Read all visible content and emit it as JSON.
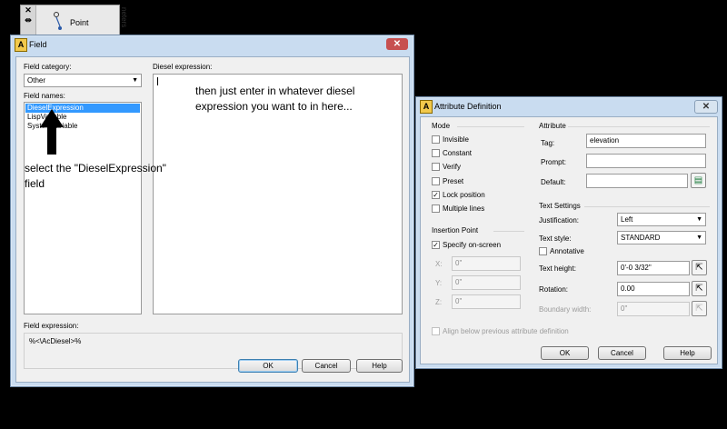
{
  "palette": {
    "close_glyph": "✕",
    "pin_glyph": "⇹",
    "item_label": "Point",
    "side_text": "neters"
  },
  "field_dialog": {
    "title": "Field",
    "close_glyph": "✕",
    "category_label": "Field category:",
    "category_value": "Other",
    "names_label": "Field names:",
    "names": [
      "DieselExpression",
      "LispVariable",
      "SystemVariable"
    ],
    "selected_name": "DieselExpression",
    "diesel_label": "Diesel expression:",
    "expression_label": "Field expression:",
    "expression_value": "%<\\AcDiesel>%",
    "ok": "OK",
    "cancel": "Cancel",
    "help": "Help"
  },
  "annotations": {
    "right_note": "then just enter in whatever diesel expression you want to in here...",
    "left_note": "select the \"DieselExpression\" field"
  },
  "attr_dialog": {
    "title": "Attribute Definition",
    "close_glyph": "✕",
    "mode_label": "Mode",
    "modes": [
      {
        "label": "Invisible",
        "checked": false
      },
      {
        "label": "Constant",
        "checked": false
      },
      {
        "label": "Verify",
        "checked": false
      },
      {
        "label": "Preset",
        "checked": false
      },
      {
        "label": "Lock position",
        "checked": true
      },
      {
        "label": "Multiple lines",
        "checked": false
      }
    ],
    "attribute_label": "Attribute",
    "tag_label": "Tag:",
    "tag_value": "elevation",
    "prompt_label": "Prompt:",
    "prompt_value": "",
    "default_label": "Default:",
    "default_value": "",
    "insertion_label": "Insertion Point",
    "specify_label": "Specify on-screen",
    "x_label": "X:",
    "x_value": "0\"",
    "y_label": "Y:",
    "y_value": "0\"",
    "z_label": "Z:",
    "z_value": "0\"",
    "text_settings_label": "Text Settings",
    "justification_label": "Justification:",
    "justification_value": "Left",
    "text_style_label": "Text style:",
    "text_style_value": "STANDARD",
    "annotative_label": "Annotative",
    "text_height_label": "Text height:",
    "text_height_value": "0'-0 3/32\"",
    "rotation_label": "Rotation:",
    "rotation_value": "0.00",
    "boundary_label": "Boundary width:",
    "boundary_value": "0\"",
    "align_label": "Align below previous attribute definition",
    "ok": "OK",
    "cancel": "Cancel",
    "help": "Help"
  }
}
